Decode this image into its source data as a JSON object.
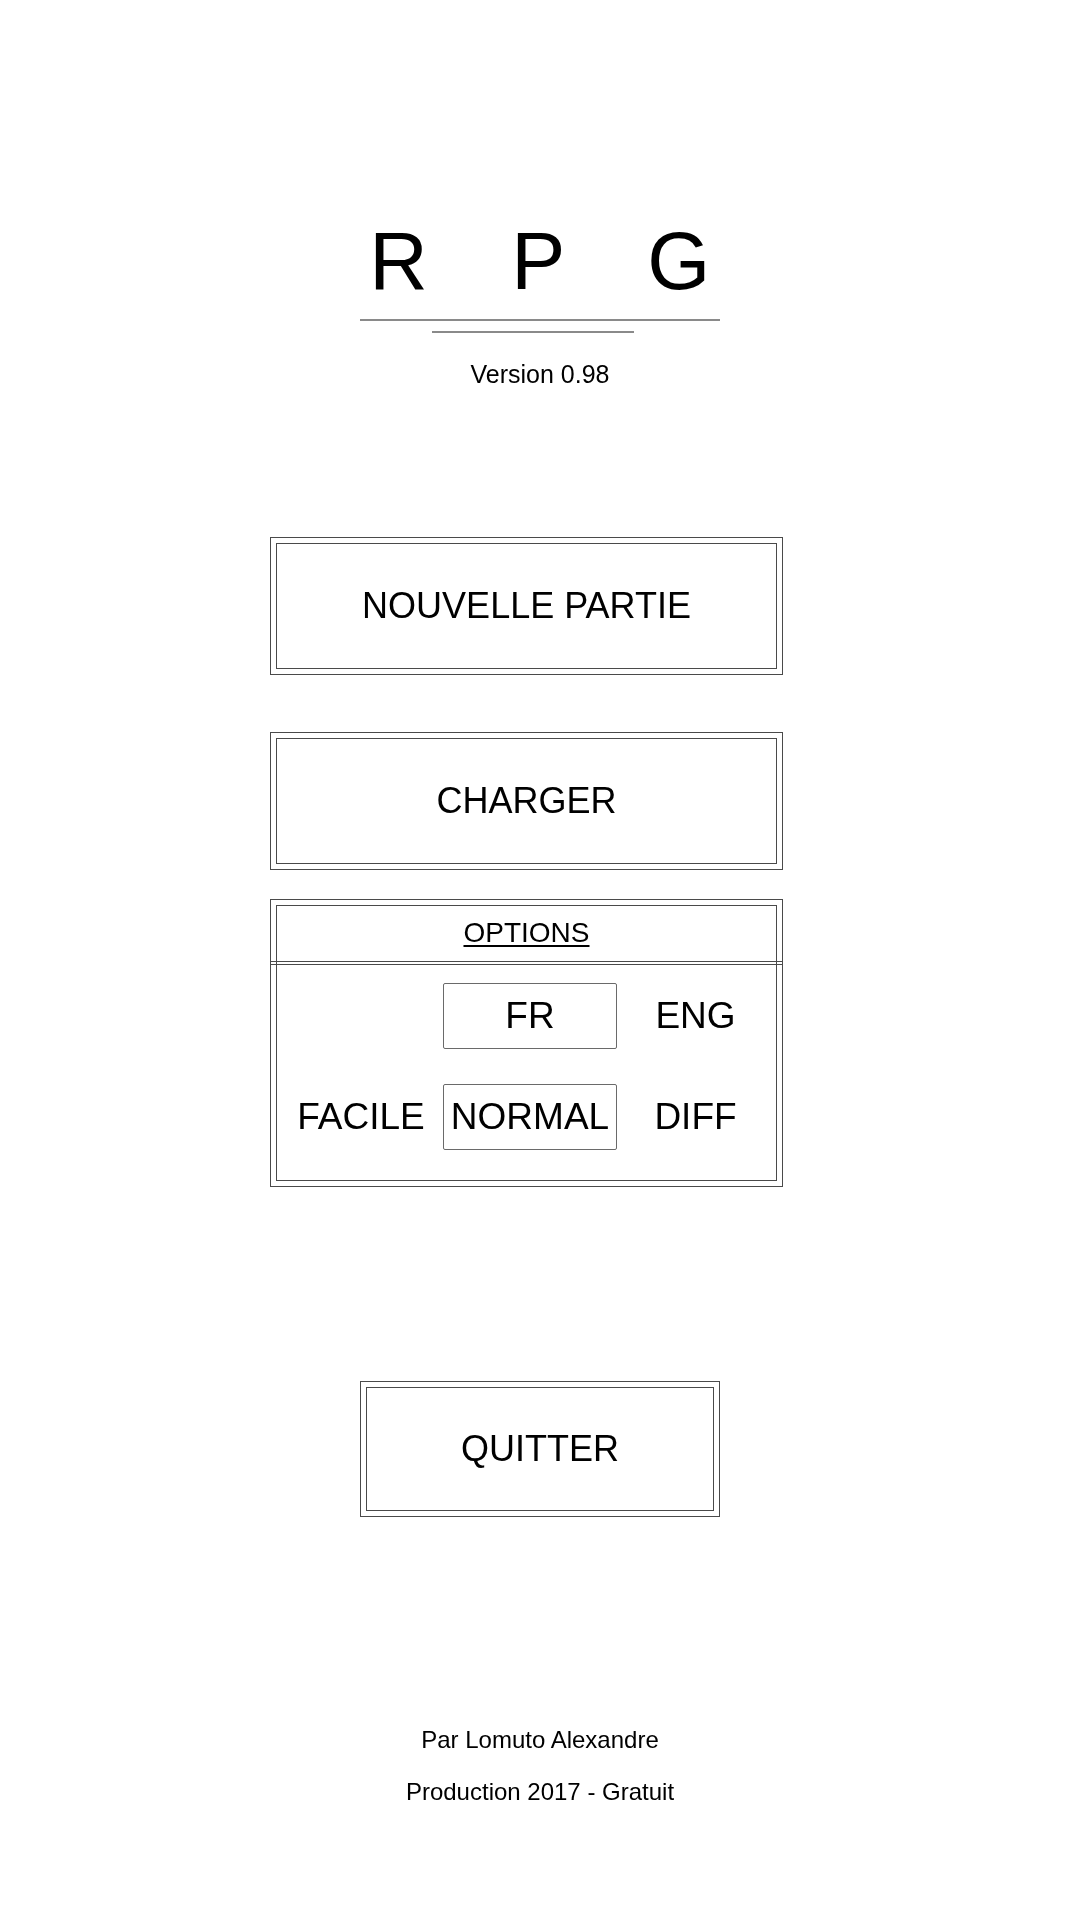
{
  "title": "R P G",
  "version": "Version 0.98",
  "menu_buttons": [
    {
      "label": "NOUVELLE PARTIE"
    },
    {
      "label": "CHARGER"
    }
  ],
  "options": {
    "heading": "OPTIONS",
    "rows": [
      {
        "items": [
          {
            "label": "FR",
            "selected": true
          },
          {
            "label": "ENG",
            "selected": false
          }
        ]
      },
      {
        "items": [
          {
            "label": "FACILE",
            "selected": false
          },
          {
            "label": "NORMAL",
            "selected": true
          },
          {
            "label": "DIFF",
            "selected": false
          }
        ]
      }
    ]
  },
  "quit_button": {
    "label": "QUITTER"
  },
  "footer": [
    "Par Lomuto Alexandre",
    "Production 2017 - Gratuit"
  ]
}
